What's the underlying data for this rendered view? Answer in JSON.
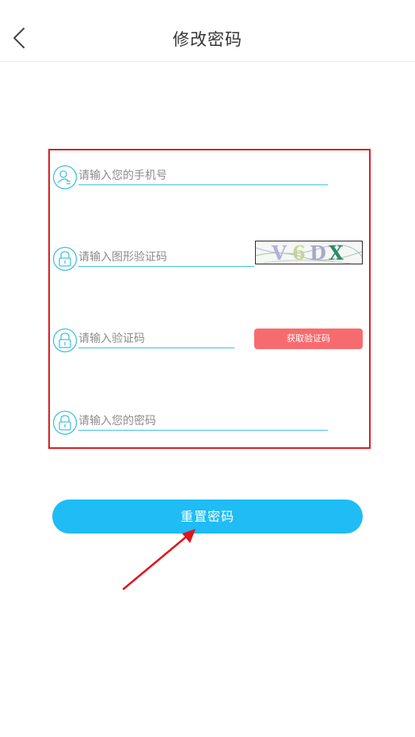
{
  "header": {
    "title": "修改密码"
  },
  "form": {
    "phone_placeholder": "请输入您的手机号",
    "captcha_placeholder": "请输入图形验证码",
    "captcha_chars": [
      "V",
      "6",
      "D",
      "X"
    ],
    "sms_code_placeholder": "请输入验证码",
    "sms_button_label": "获取验证码",
    "password_placeholder": "请输入您的密码"
  },
  "actions": {
    "submit_label": "重置密码"
  },
  "colors": {
    "accent": "#1fbcf6",
    "field_line": "#43c2dc",
    "sms_button": "#f76b6e",
    "highlight_box": "#d91e22",
    "annotation_arrow": "#e0161c"
  },
  "icons": {
    "back": "chevron-left-icon",
    "phone": "user-icon",
    "lock": "lock-icon"
  }
}
